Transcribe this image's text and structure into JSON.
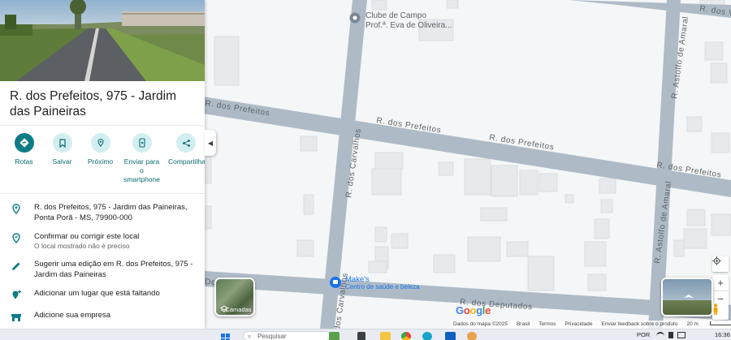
{
  "place": {
    "title": "R. dos Prefeitos, 975 - Jardim das Paineiras"
  },
  "actions": [
    {
      "label": "Rotas",
      "icon": "directions-icon"
    },
    {
      "label": "Salvar",
      "icon": "bookmark-icon"
    },
    {
      "label": "Próximo",
      "icon": "nearby-icon"
    },
    {
      "label": "Enviar para o smartphone",
      "icon": "send-to-phone-icon"
    },
    {
      "label": "Compartilhar",
      "icon": "share-icon"
    }
  ],
  "info": {
    "address_line1": "R. dos Prefeitos, 975 - Jardim das Paineiras,",
    "address_line2": "Ponta Porã - MS, 79900-000",
    "confirm_title": "Confirmar ou corrigir este local",
    "confirm_sub": "O local mostrado não é preciso",
    "suggest_line1": "Sugerir uma edição em R. dos Prefeitos, 975 -",
    "suggest_line2": "Jardim das Paineiras",
    "add_place": "Adicionar um lugar que está faltando",
    "add_business": "Adicione sua empresa"
  },
  "map": {
    "poi_club_line1": "Clube de Campo",
    "poi_club_line2": "Prof.ª. Eva de Oliveira...",
    "poi_makes_line1": "Make's",
    "poi_makes_line2": "Centro de saúde e beleza",
    "roads": {
      "prefeitos": "R. dos Prefeitos",
      "carvalhos": "R. dos Carvalhos",
      "astolfo": "R. Astolfo de Amaral",
      "deputados": "R. dos Deputados",
      "vereadores": "R. dos V"
    },
    "layers_label": "Camadas",
    "google": "Google"
  },
  "footer": {
    "data": "Dados do mapa ©2025",
    "country": "Brasil",
    "terms": "Termos",
    "privacy": "Privacidade",
    "feedback": "Enviar feedback sobre o produto",
    "scale": "20 m"
  },
  "taskbar": {
    "search_placeholder": "Pesquisar",
    "lang": "POR",
    "time": "16:36"
  },
  "colors": {
    "accent": "#0e7c86",
    "road": "#aebbc7",
    "block": "#e8eaed"
  }
}
